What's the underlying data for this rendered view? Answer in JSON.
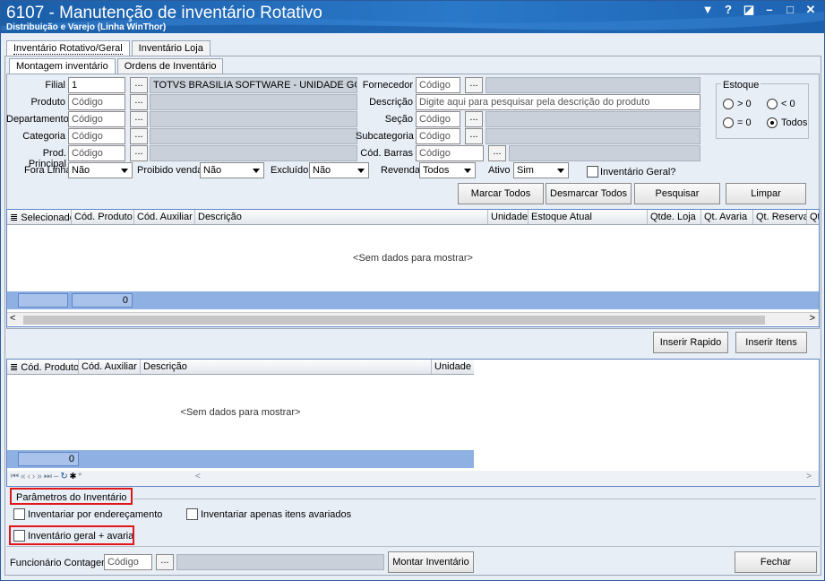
{
  "window": {
    "title": "6107 - Manutenção de inventário Rotativo",
    "subtitle": "Distribuição e Varejo (Linha WinThor)",
    "controls": [
      "▼",
      "?",
      "◪",
      "–",
      "□",
      "✕"
    ]
  },
  "tabs_main": [
    "Inventário Rotativo/Geral",
    "Inventário Loja"
  ],
  "tabs_sub": [
    "Montagem inventário",
    "Ordens de Inventário"
  ],
  "form": {
    "filial_label": "Filial",
    "filial_value": "1",
    "filial_desc": "TOTVS BRASILIA SOFTWARE - UNIDADE GOIANI",
    "produto_label": "Produto",
    "produto_ph": "Código",
    "departamento_label": "Departamento",
    "departamento_ph": "Código",
    "categoria_label": "Categoria",
    "categoria_ph": "Código",
    "prod_principal_label": "Prod. Principal",
    "prod_principal_ph": "Código",
    "fornecedor_label": "Fornecedor",
    "fornecedor_ph": "Código",
    "descricao_label": "Descrição",
    "descricao_ph": "Digite aqui para pesquisar pela descrição do produto",
    "secao_label": "Seção",
    "secao_ph": "Código",
    "subcategoria_label": "Subcategoria",
    "subcategoria_ph": "Código",
    "cod_barras_label": "Cód. Barras",
    "cod_barras_ph": "Código",
    "ellipsis": "...",
    "fora_linha_label": "Fora Linha",
    "fora_linha_value": "Não",
    "proibido_label": "Proibido venda",
    "proibido_value": "Não",
    "excluido_label": "Excluído",
    "excluido_value": "Não",
    "revenda_label": "Revenda",
    "revenda_value": "Todos",
    "ativo_label": "Ativo",
    "ativo_value": "Sim",
    "inv_geral_label": "Inventário Geral?"
  },
  "estoque": {
    "title": "Estoque",
    "options": [
      "> 0",
      "< 0",
      "= 0",
      "Todos"
    ],
    "selected": "Todos"
  },
  "buttons": {
    "marcar": "Marcar Todos",
    "desmarcar": "Desmarcar Todos",
    "pesquisar": "Pesquisar",
    "limpar": "Limpar",
    "inserir_rapido": "Inserir Rapido",
    "inserir_itens": "Inserir Itens",
    "montar": "Montar Inventário",
    "fechar": "Fechar"
  },
  "grid1": {
    "columns": [
      "Selecionado",
      "Cód. Produto",
      "Cód. Auxiliar",
      "Descrição",
      "Unidade",
      "Estoque Atual",
      "Qtde. Loja",
      "Qt. Avaria",
      "Qt. Reserva",
      "Qt"
    ],
    "empty_text": "<Sem dados para mostrar>",
    "footer_count": "0"
  },
  "grid2": {
    "columns": [
      "Cód. Produto",
      "Cód. Auxiliar",
      "Descrição",
      "Unidade"
    ],
    "empty_text": "<Sem dados para mostrar>",
    "footer_count": "0"
  },
  "params": {
    "title": "Parâmetros do Inventário",
    "por_endereco": "Inventariar por endereçamento",
    "apenas_avariados": "Inventariar apenas itens avariados",
    "geral_avaria": "Inventário geral + avaria"
  },
  "funcionario": {
    "label": "Funcionário Contagem",
    "placeholder": "Código"
  }
}
